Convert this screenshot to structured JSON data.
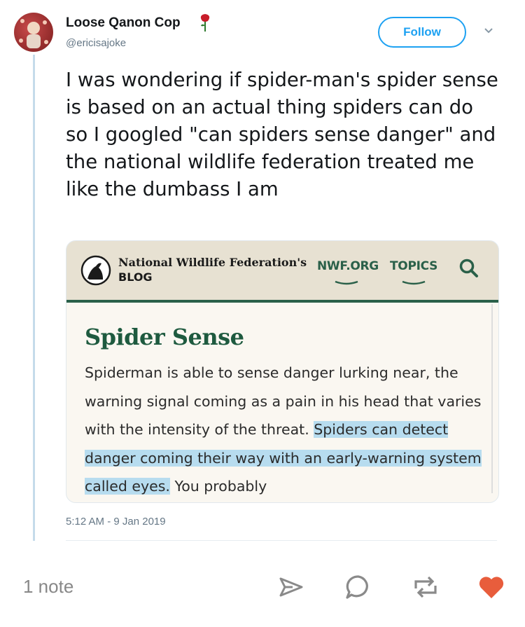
{
  "tweet": {
    "display_name": "Loose Qanon Cop",
    "handle": "@ericisajoke",
    "follow_label": "Follow",
    "text": "I was wondering if spider-man's spider sense is based on an actual thing spiders can do so I googled \"can spiders sense danger\" and the national wildlife federation treated me like the dumbass I am",
    "timestamp": "5:12 AM - 9 Jan 2019"
  },
  "card": {
    "site_title": "National Wildlife Federation's",
    "site_sub": "BLOG",
    "nav": [
      "NWF.ORG",
      "TOPICS"
    ],
    "article_title": "Spider Sense",
    "body_plain": "Spiderman is able to sense danger lurking near, the warning signal coming as a pain in his head that varies with the intensity of the threat. ",
    "body_highlighted": "Spiders can detect danger coming their way with an early-warning system called eyes.",
    "body_tail": " You probably"
  },
  "footer": {
    "notes": "1 note"
  },
  "icons": [
    "rose-icon",
    "chevron-down-icon",
    "nwf-logo-icon",
    "search-icon",
    "share-icon",
    "reply-icon",
    "reblog-icon",
    "like-heart-icon"
  ],
  "colors": {
    "follow_blue": "#1da1f2",
    "nwf_green": "#2a6049",
    "highlight": "#b7dcef",
    "heart": "#e85d3c"
  }
}
